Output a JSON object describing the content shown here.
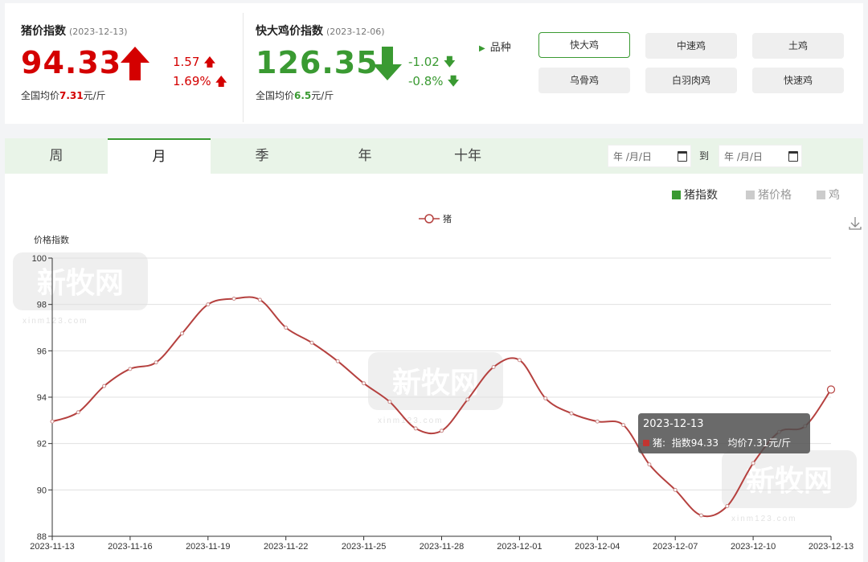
{
  "pig": {
    "title": "猪价指数",
    "date": "(2023-12-13)",
    "value": "94.33",
    "change_abs": "1.57",
    "change_pct": "1.69%",
    "avg_prefix": "全国均价",
    "avg_value": "7.31",
    "avg_unit": "元/斤"
  },
  "chicken": {
    "title": "快大鸡价指数",
    "date": "(2023-12-06)",
    "value": "126.35",
    "change_abs": "-1.02",
    "change_pct": "-0.8%",
    "avg_prefix": "全国均价",
    "avg_value": "6.5",
    "avg_unit": "元/斤"
  },
  "variety": {
    "label": "品种",
    "buttons": [
      "快大鸡",
      "中速鸡",
      "土鸡",
      "乌骨鸡",
      "白羽肉鸡",
      "快速鸡"
    ],
    "selected": "快大鸡"
  },
  "tabs": [
    "周",
    "月",
    "季",
    "年",
    "十年"
  ],
  "active_tab": "月",
  "date_range": {
    "start_placeholder": "年 /月/日",
    "end_placeholder": "年 /月/日",
    "to_label": "到"
  },
  "series_toggle": [
    "猪指数",
    "猪价格",
    "鸡"
  ],
  "colors": {
    "accent_green": "#3a9a32",
    "rise_red": "#d40000",
    "line_color": "#b5413f"
  },
  "watermark": {
    "text": "新牧网",
    "sub": "xinm123.com"
  },
  "tooltip": {
    "date": "2023-12-13",
    "series": "猪:",
    "index_label": "指数94.33",
    "price_label": "均价7.31元/斤"
  },
  "chart_data": {
    "type": "line",
    "legend": [
      "猪"
    ],
    "ylabel": "价格指数",
    "ylim": [
      88,
      100
    ],
    "yticks": [
      88,
      90,
      92,
      94,
      96,
      98,
      100
    ],
    "xtick_labels": [
      "2023-11-13",
      "2023-11-16",
      "2023-11-19",
      "2023-11-22",
      "2023-11-25",
      "2023-11-28",
      "2023-12-01",
      "2023-12-04",
      "2023-12-07",
      "2023-12-10",
      "2023-12-13"
    ],
    "x": [
      "2023-11-13",
      "2023-11-14",
      "2023-11-15",
      "2023-11-16",
      "2023-11-17",
      "2023-11-18",
      "2023-11-19",
      "2023-11-20",
      "2023-11-21",
      "2023-11-22",
      "2023-11-23",
      "2023-11-24",
      "2023-11-25",
      "2023-11-26",
      "2023-11-27",
      "2023-11-28",
      "2023-11-29",
      "2023-11-30",
      "2023-12-01",
      "2023-12-02",
      "2023-12-03",
      "2023-12-04",
      "2023-12-05",
      "2023-12-06",
      "2023-12-07",
      "2023-12-08",
      "2023-12-09",
      "2023-12-10",
      "2023-12-11",
      "2023-12-12",
      "2023-12-13"
    ],
    "series": [
      {
        "name": "猪",
        "values": [
          92.95,
          93.35,
          94.48,
          95.22,
          95.5,
          96.75,
          98.0,
          98.25,
          98.2,
          97.0,
          96.35,
          95.55,
          94.6,
          93.8,
          92.65,
          92.55,
          93.9,
          95.3,
          95.6,
          93.95,
          93.3,
          92.95,
          92.8,
          91.1,
          90.0,
          88.9,
          89.3,
          91.15,
          92.5,
          92.75,
          94.33
        ]
      }
    ],
    "grid": true,
    "legend_position": "top-center"
  }
}
